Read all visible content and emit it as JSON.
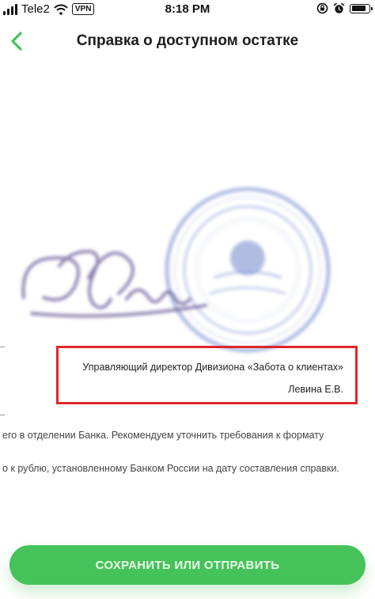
{
  "status_bar": {
    "carrier": "Tele2",
    "vpn_label": "VPN",
    "time": "8:18 PM",
    "battery_level_percent": 85
  },
  "header": {
    "back_icon": "chevron-left-icon",
    "title": "Справка о доступном остатке"
  },
  "document": {
    "signer_title": "Управляющий директор Дивизиона «Забота о клиентах»",
    "signer_name": "Левина Е.В.",
    "note_line_1": "его в отделении Банка. Рекомендуем уточнить требования к формату",
    "note_line_2": "о к рублю, установленному Банком России на дату составления справки."
  },
  "actions": {
    "save_label": "СОХРАНИТЬ ИЛИ ОТПРАВИТЬ"
  },
  "colors": {
    "accent_green": "#45c35a",
    "highlight_red": "#e0262a",
    "stamp_blue": "#8aa0d8",
    "signature_purple": "#6a5a9a"
  }
}
